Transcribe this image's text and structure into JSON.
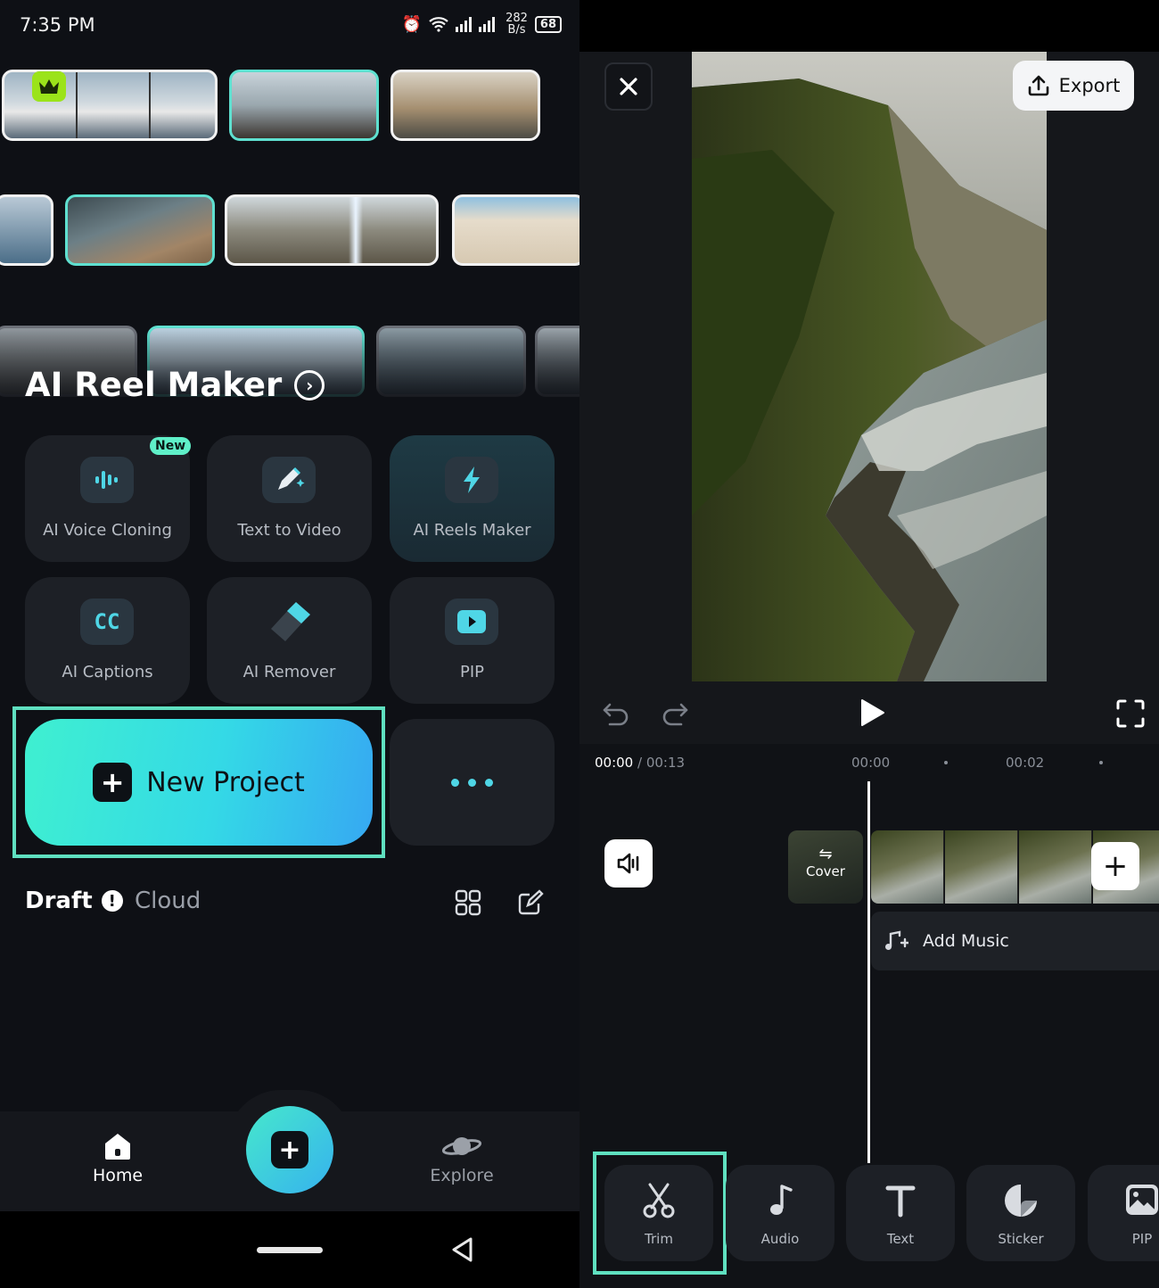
{
  "status_bar": {
    "time": "7:35 PM",
    "net_speed_value": "282",
    "net_speed_unit": "B/s",
    "battery": "68"
  },
  "home": {
    "ai_reel_maker": {
      "title": "AI Reel Maker"
    },
    "tools": [
      {
        "label": "AI Voice Cloning",
        "badge": "New",
        "icon": "voice-wave-icon"
      },
      {
        "label": "Text to Video",
        "icon": "pen-sparkle-icon"
      },
      {
        "label": "AI Reels Maker",
        "icon": "lightning-icon",
        "active": true
      },
      {
        "label": "AI Captions",
        "icon": "cc-icon"
      },
      {
        "label": "AI Remover",
        "icon": "eraser-icon"
      },
      {
        "label": "PIP",
        "icon": "pip-icon"
      }
    ],
    "new_project_label": "New Project",
    "projects_tabs": {
      "draft": "Draft",
      "cloud": "Cloud"
    }
  },
  "bottom_nav": {
    "home": "Home",
    "explore": "Explore"
  },
  "editor": {
    "export_label": "Export",
    "timecode_current": "00:00",
    "timecode_total": "/ 00:13",
    "ticks": [
      "00:00",
      "00:02"
    ],
    "cover_label": "Cover",
    "add_music_label": "Add Music",
    "bottom_tools": [
      {
        "label": "Trim",
        "icon": "scissors-icon"
      },
      {
        "label": "Audio",
        "icon": "music-note-icon"
      },
      {
        "label": "Text",
        "icon": "text-t-icon"
      },
      {
        "label": "Sticker",
        "icon": "sticker-icon"
      },
      {
        "label": "PIP",
        "icon": "image-icon"
      }
    ]
  },
  "colors": {
    "accent": "#3ff0d0",
    "highlight": "#5fe0c0",
    "background": "#0e1015"
  }
}
